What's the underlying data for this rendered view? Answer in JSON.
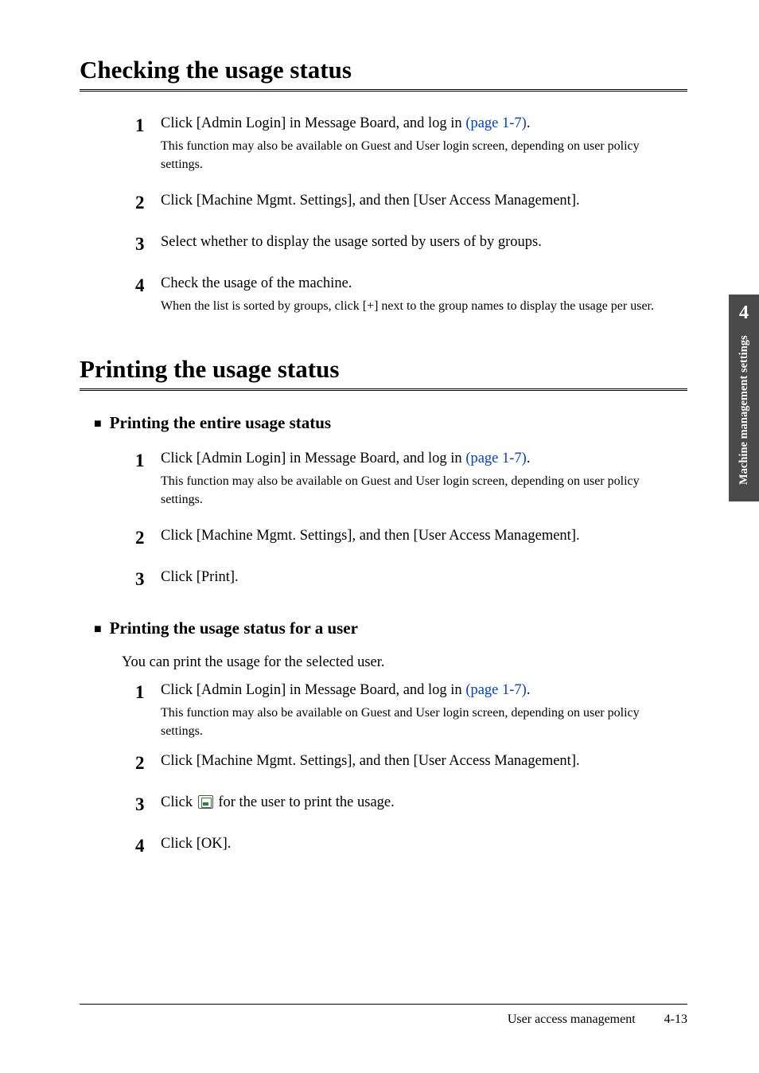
{
  "headings": {
    "checking": "Checking the usage status",
    "printing": "Printing the usage status",
    "sub_entire": "Printing the entire usage status",
    "sub_user": "Printing the usage status for a user"
  },
  "intro_user": "You can print the usage for the selected user.",
  "steps_checking": {
    "s1_main_a": "Click [Admin Login] in Message Board, and log in ",
    "s1_link": "(page 1-7)",
    "s1_main_b": ".",
    "s1_sub": "This function may also be available on Guest and User login screen, depending on user policy settings.",
    "s2_main": "Click [Machine Mgmt. Settings], and then [User Access Management].",
    "s3_main": "Select whether to display the usage sorted by users of by groups.",
    "s4_main": "Check the usage of the machine.",
    "s4_sub": "When the list is sorted by groups, click [+] next to the group names to display the usage per user."
  },
  "steps_entire": {
    "s1_main_a": "Click [Admin Login] in Message Board, and log in ",
    "s1_link": "(page 1-7)",
    "s1_main_b": ".",
    "s1_sub": "This function may also be available on Guest and User login screen, depending on user policy settings.",
    "s2_main": "Click [Machine Mgmt. Settings], and then [User Access Management].",
    "s3_main": "Click [Print]."
  },
  "steps_user": {
    "s1_main_a": "Click [Admin Login] in Message Board, and log in ",
    "s1_link": "(page 1-7)",
    "s1_main_b": ".",
    "s1_sub": "This function may also be available on Guest and User login screen, depending on user policy settings.",
    "s2_main": "Click [Machine Mgmt. Settings], and then [User Access Management].",
    "s3_main_a": "Click ",
    "s3_main_b": " for the user to print the usage.",
    "s4_main": "Click [OK]."
  },
  "sidebar": {
    "chapter_num": "4",
    "chapter_label": "Machine management settings"
  },
  "footer": {
    "section": "User access management",
    "page": "4-13"
  },
  "nums": {
    "n1": "1",
    "n2": "2",
    "n3": "3",
    "n4": "4"
  }
}
